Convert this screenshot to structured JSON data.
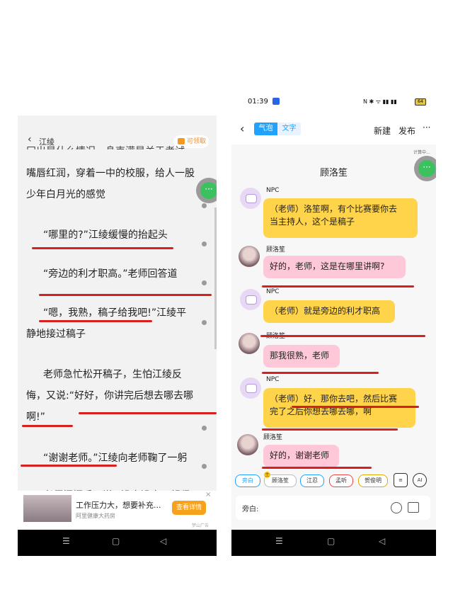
{
  "left": {
    "back_label": "江绫",
    "coupon_label": "可领取",
    "partial_line": "冂出是什么情况，身束满是关于考试",
    "paragraphs": [
      {
        "line1": "嘴唇红润，穿着一中的校服，给人一股",
        "line2": "少年白月光的感觉"
      },
      {
        "line1": "“哪里的?”江绫缓慢的抬起头"
      },
      {
        "line1": "“旁边的利才职高。”老师回答道"
      },
      {
        "line1": "“嗯，我熟，稿子给我吧!”江绫平",
        "line2": "静地接过稿子"
      },
      {
        "line1": "老师急忙松开稿子，生怕江绫反",
        "line2": "悔，又说:“好好，你讲完后想去哪去哪",
        "line3": "啊!”"
      },
      {
        "line1": "“谢谢老师。”江绫向老师鞠了一躬"
      }
    ],
    "cut_line": "老师摆摆手，说 “没事没事，赶紧",
    "fab_label": "···",
    "ad": {
      "title": "工作压力大，想要补充...",
      "subtitle": "阿里健康大药房",
      "button": "查看详情",
      "close": "×",
      "mark": "梦山广告"
    },
    "nav": [
      "☰",
      "▢",
      "◁"
    ]
  },
  "right": {
    "status_time": "01:39",
    "status_icons": "N ✱ ᯤ ▮▮ ▮▮",
    "battery": "64",
    "tabs": [
      "气泡",
      "文字"
    ],
    "new_label": "新建",
    "publish_label": "发布",
    "more_label": "···",
    "calc_label": "计算中...",
    "fab_label": "···",
    "chat_title": "顾洛笙",
    "messages": [
      {
        "speaker": "NPC",
        "line1": "（老师）洛笙啊，有个比赛要你去",
        "line2": "当主持人，这个是稿子"
      },
      {
        "speaker": "顾洛笙",
        "line1": "好的，老师，这是在哪里讲啊?"
      },
      {
        "speaker": "NPC",
        "line1": "（老师）就是旁边的利才职高"
      },
      {
        "speaker": "顾洛笙",
        "line1": "那我很熟，老师"
      },
      {
        "speaker": "NPC",
        "line1": "（老师）好，那你去吧，然后比赛",
        "line2": "完了之后你想去哪去哪，啊"
      },
      {
        "speaker": "顾洛笙",
        "line1": "好的，谢谢老师"
      }
    ],
    "chips": [
      "旁白",
      "顾洛笙",
      "江忍",
      "孟听",
      "贺俊明"
    ],
    "chip_badge": "主",
    "role_icon": "≡",
    "ai_label": "AI",
    "input_placeholder": "旁白:",
    "nav": [
      "☰",
      "▢",
      "◁"
    ]
  },
  "colors": {
    "accent_blue": "#1fa3ff",
    "bubble_yellow": "#ffd44a",
    "bubble_pink": "#ffc8d8",
    "annotation_red": "#d81f1f",
    "ad_button": "#f7a21c"
  }
}
